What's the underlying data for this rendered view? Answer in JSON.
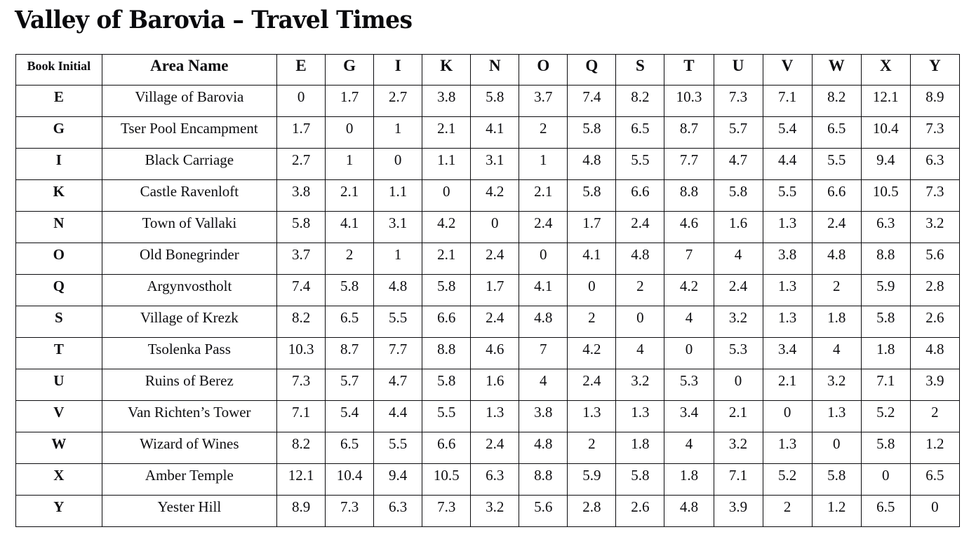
{
  "document": {
    "title": "Valley of Barovia – Travel Times",
    "background_color": "#ffffff",
    "text_color": "#0d0d10",
    "border_color": "#0b0b0e"
  },
  "table": {
    "headers": {
      "initial": "Book Initial",
      "area": "Area Name",
      "letters": [
        "E",
        "G",
        "I",
        "K",
        "N",
        "O",
        "Q",
        "S",
        "T",
        "U",
        "V",
        "W",
        "X",
        "Y"
      ]
    },
    "rows": [
      {
        "initial": "E",
        "area": "Village of Barovia",
        "values": [
          "0",
          "1.7",
          "2.7",
          "3.8",
          "5.8",
          "3.7",
          "7.4",
          "8.2",
          "10.3",
          "7.3",
          "7.1",
          "8.2",
          "12.1",
          "8.9"
        ]
      },
      {
        "initial": "G",
        "area": "Tser Pool Encampment",
        "values": [
          "1.7",
          "0",
          "1",
          "2.1",
          "4.1",
          "2",
          "5.8",
          "6.5",
          "8.7",
          "5.7",
          "5.4",
          "6.5",
          "10.4",
          "7.3"
        ]
      },
      {
        "initial": "I",
        "area": "Black Carriage",
        "values": [
          "2.7",
          "1",
          "0",
          "1.1",
          "3.1",
          "1",
          "4.8",
          "5.5",
          "7.7",
          "4.7",
          "4.4",
          "5.5",
          "9.4",
          "6.3"
        ]
      },
      {
        "initial": "K",
        "area": "Castle Ravenloft",
        "values": [
          "3.8",
          "2.1",
          "1.1",
          "0",
          "4.2",
          "2.1",
          "5.8",
          "6.6",
          "8.8",
          "5.8",
          "5.5",
          "6.6",
          "10.5",
          "7.3"
        ]
      },
      {
        "initial": "N",
        "area": "Town of Vallaki",
        "values": [
          "5.8",
          "4.1",
          "3.1",
          "4.2",
          "0",
          "2.4",
          "1.7",
          "2.4",
          "4.6",
          "1.6",
          "1.3",
          "2.4",
          "6.3",
          "3.2"
        ]
      },
      {
        "initial": "O",
        "area": "Old Bonegrinder",
        "values": [
          "3.7",
          "2",
          "1",
          "2.1",
          "2.4",
          "0",
          "4.1",
          "4.8",
          "7",
          "4",
          "3.8",
          "4.8",
          "8.8",
          "5.6"
        ]
      },
      {
        "initial": "Q",
        "area": "Argynvostholt",
        "values": [
          "7.4",
          "5.8",
          "4.8",
          "5.8",
          "1.7",
          "4.1",
          "0",
          "2",
          "4.2",
          "2.4",
          "1.3",
          "2",
          "5.9",
          "2.8"
        ]
      },
      {
        "initial": "S",
        "area": "Village of Krezk",
        "values": [
          "8.2",
          "6.5",
          "5.5",
          "6.6",
          "2.4",
          "4.8",
          "2",
          "0",
          "4",
          "3.2",
          "1.3",
          "1.8",
          "5.8",
          "2.6"
        ]
      },
      {
        "initial": "T",
        "area": "Tsolenka Pass",
        "values": [
          "10.3",
          "8.7",
          "7.7",
          "8.8",
          "4.6",
          "7",
          "4.2",
          "4",
          "0",
          "5.3",
          "3.4",
          "4",
          "1.8",
          "4.8"
        ]
      },
      {
        "initial": "U",
        "area": "Ruins of Berez",
        "values": [
          "7.3",
          "5.7",
          "4.7",
          "5.8",
          "1.6",
          "4",
          "2.4",
          "3.2",
          "5.3",
          "0",
          "2.1",
          "3.2",
          "7.1",
          "3.9"
        ]
      },
      {
        "initial": "V",
        "area": "Van Richten’s Tower",
        "values": [
          "7.1",
          "5.4",
          "4.4",
          "5.5",
          "1.3",
          "3.8",
          "1.3",
          "1.3",
          "3.4",
          "2.1",
          "0",
          "1.3",
          "5.2",
          "2"
        ]
      },
      {
        "initial": "W",
        "area": "Wizard of Wines",
        "values": [
          "8.2",
          "6.5",
          "5.5",
          "6.6",
          "2.4",
          "4.8",
          "2",
          "1.8",
          "4",
          "3.2",
          "1.3",
          "0",
          "5.8",
          "1.2"
        ]
      },
      {
        "initial": "X",
        "area": "Amber Temple",
        "values": [
          "12.1",
          "10.4",
          "9.4",
          "10.5",
          "6.3",
          "8.8",
          "5.9",
          "5.8",
          "1.8",
          "7.1",
          "5.2",
          "5.8",
          "0",
          "6.5"
        ]
      },
      {
        "initial": "Y",
        "area": "Yester Hill",
        "values": [
          "8.9",
          "7.3",
          "6.3",
          "7.3",
          "3.2",
          "5.6",
          "2.8",
          "2.6",
          "4.8",
          "3.9",
          "2",
          "1.2",
          "6.5",
          "0"
        ]
      }
    ]
  }
}
